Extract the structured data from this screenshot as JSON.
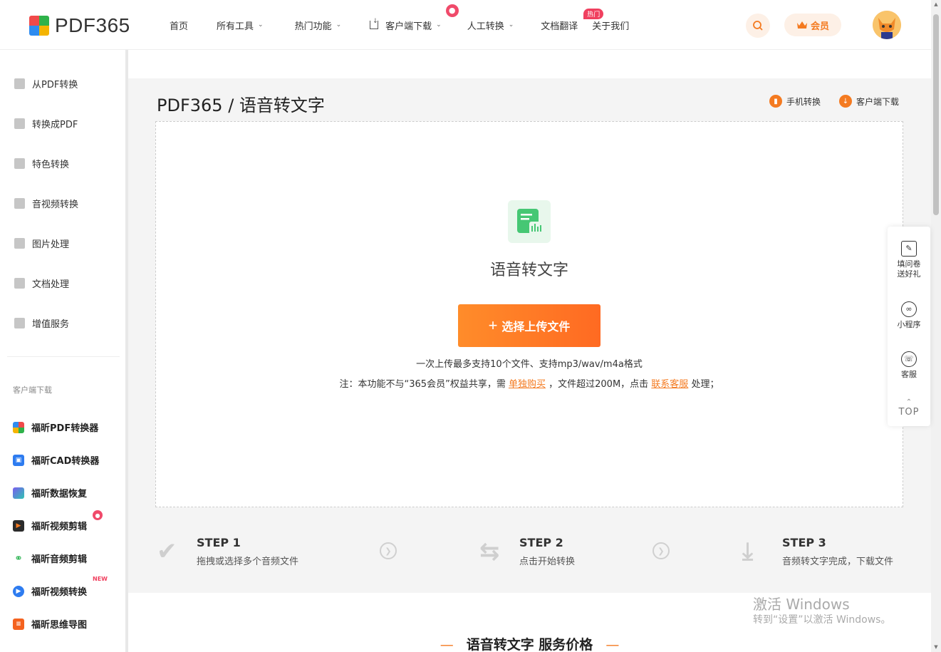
{
  "brand": {
    "name": "PDF365",
    "colors": [
      "#f04a4a",
      "#2fb24a",
      "#2e8cf0",
      "#f4b400"
    ],
    "accent": "#f47a20"
  },
  "nav": {
    "items": [
      {
        "label": "首页",
        "caret": false
      },
      {
        "label": "所有工具",
        "caret": true
      },
      {
        "label": "热门功能",
        "caret": true
      },
      {
        "label": "客户端下载",
        "caret": true,
        "icon": "download-icon"
      },
      {
        "label": "人工转换",
        "caret": true,
        "icon": "fire-icon"
      },
      {
        "label": "文档翻译",
        "caret": false,
        "badge": "热门"
      },
      {
        "label": "关于我们",
        "caret": false
      }
    ],
    "vip_label": "会员"
  },
  "sidebar": {
    "categories": [
      {
        "label": "从PDF转换",
        "icon": "from-pdf-icon"
      },
      {
        "label": "转换成PDF",
        "icon": "to-pdf-icon"
      },
      {
        "label": "特色转换",
        "icon": "star-icon"
      },
      {
        "label": "音视频转换",
        "icon": "video-icon"
      },
      {
        "label": "图片处理",
        "icon": "image-icon"
      },
      {
        "label": "文档处理",
        "icon": "document-icon"
      },
      {
        "label": "增值服务",
        "icon": "list-icon"
      }
    ],
    "download_heading": "客户端下载",
    "apps": [
      {
        "label": "福昕PDF转换器",
        "color": "#4a90e2"
      },
      {
        "label": "福昕CAD转换器",
        "color": "#2e7cf0"
      },
      {
        "label": "福昕数据恢复",
        "color": "#7b5cf0"
      },
      {
        "label": "福昕视频剪辑",
        "color": "#2b2b2b",
        "badge": "fire"
      },
      {
        "label": "福昕音频剪辑",
        "color": "#22b04a"
      },
      {
        "label": "福昕视频转换",
        "color": "#2e7cf0",
        "badge": "NEW"
      },
      {
        "label": "福昕思维导图",
        "color": "#f4621f"
      }
    ]
  },
  "page": {
    "title": "PDF365 / 语音转文字",
    "mobile_link": "手机转换",
    "client_link": "客户端下载"
  },
  "upload": {
    "tool_name": "语音转文字",
    "button_label": "选择上传文件",
    "hint_line1": "一次上传最多支持10个文件、支持mp3/wav/m4a格式",
    "hint_pre": "注：本功能不与“365会员”权益共享，需",
    "hint_link1": "单独购买",
    "hint_mid": "，文件超过200M，点击",
    "hint_link2": "联系客服",
    "hint_post": "处理；"
  },
  "steps": [
    {
      "title": "STEP 1",
      "desc": "拖拽或选择多个音频文件"
    },
    {
      "title": "STEP 2",
      "desc": "点击开始转换"
    },
    {
      "title": "STEP 3",
      "desc": "音频转文字完成，下载文件"
    }
  ],
  "pricing": {
    "title": "语音转文字 服务价格"
  },
  "float_panel": {
    "survey_line1": "填问卷",
    "survey_line2": "送好礼",
    "miniapp": "小程序",
    "service": "客服",
    "top": "TOP"
  },
  "watermark": {
    "line1": "激活 Windows",
    "line2": "转到“设置”以激活 Windows。"
  }
}
